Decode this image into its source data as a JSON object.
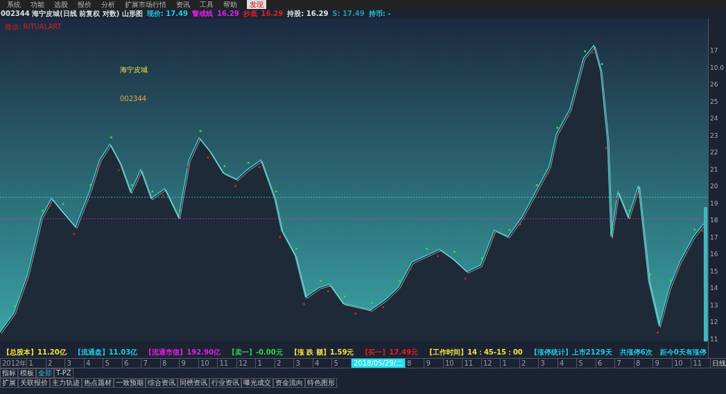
{
  "menu": [
    {
      "label": "系统",
      "selected": false
    },
    {
      "label": "功能",
      "selected": false
    },
    {
      "label": "选股",
      "selected": false
    },
    {
      "label": "报价",
      "selected": false
    },
    {
      "label": "分析",
      "selected": false
    },
    {
      "label": "扩展市场行情",
      "selected": false
    },
    {
      "label": "资讯",
      "selected": false
    },
    {
      "label": "工具",
      "selected": false
    },
    {
      "label": "帮助",
      "selected": false
    },
    {
      "label": "发现",
      "selected": true
    }
  ],
  "header": {
    "title": "002344 海宁皮城(日线 前复权 对数) 山形图",
    "items": [
      {
        "label": "现价: 17.49",
        "color": "#22c8e0"
      },
      {
        "label": "警戒线",
        "color": "#e020e0"
      },
      {
        "label": "16.29",
        "color": "#e020e0"
      },
      {
        "label": "抄底",
        "color": "#e02020"
      },
      {
        "label": "16.29",
        "color": "#e02020"
      },
      {
        "label": "持股: 16.29",
        "color": "#e0e0e0"
      },
      {
        "label": "S: 17.49",
        "color": "#3090a0"
      },
      {
        "label": "持币: -",
        "color": "#22c8e0"
      }
    ],
    "wechat": "微信: RITUALART"
  },
  "chart": {
    "name": "海宁皮城",
    "code": "002344",
    "axis": [
      "17",
      "10.0",
      "26",
      "25",
      "24",
      "23",
      "22",
      "21",
      "20",
      "19",
      "18",
      "17",
      "16",
      "15",
      "14",
      "13",
      "12",
      "11"
    ]
  },
  "stats": [
    {
      "label": "【总股本】",
      "value": "11.20亿",
      "color": "#f0e040"
    },
    {
      "label": "【流通盘】",
      "value": "11.03亿",
      "color": "#22c8e0"
    },
    {
      "label": "【流通市值】",
      "value": "192.90亿",
      "color": "#e020e0"
    },
    {
      "label": "【卖一】",
      "value": "-0.00元",
      "color": "#30d040"
    },
    {
      "label": "【涨 跌 额】",
      "value": "1.59元",
      "color": "#f0e040"
    },
    {
      "label": "【买一】",
      "value": "17.49元",
      "color": "#e02020"
    },
    {
      "label": "【工作时间】",
      "value": "14：45-15：00",
      "color": "#f0e040"
    },
    {
      "label": "【涨停统计】",
      "value": "上市2129天",
      "color": "#22c8e0"
    },
    {
      "label": "共涨停6次",
      "color": "#22c8e0"
    },
    {
      "label": "距今0天有涨停",
      "color": "#22c8e0"
    }
  ],
  "timeline": {
    "ticks": [
      "2012年",
      "1",
      "2",
      "3",
      "4",
      "5",
      "6",
      "7",
      "8",
      "9",
      "10",
      "11",
      "12",
      "1",
      "2",
      "3",
      "4",
      "5"
    ],
    "cursor": "2018/05/29/二",
    "ticks2": [
      "8",
      "9",
      "10",
      "11",
      "12",
      "1",
      "2",
      "3",
      "4",
      "5",
      "6",
      "7",
      "8",
      "9",
      "10",
      "11"
    ],
    "period": "日线"
  },
  "tabs": [
    {
      "label": "指标",
      "selected": false
    },
    {
      "label": "模板",
      "selected": false
    },
    {
      "label": "全部",
      "selected": true
    },
    {
      "label": "T-PZ",
      "selected": false
    }
  ],
  "bottom_tabs": [
    "扩展",
    "关联报价",
    "主力轨迹",
    "热点题材",
    "一致预期",
    "综合资讯",
    "同榜资讯",
    "行业资讯",
    "曝光成交",
    "资金流向",
    "特色图形"
  ]
}
